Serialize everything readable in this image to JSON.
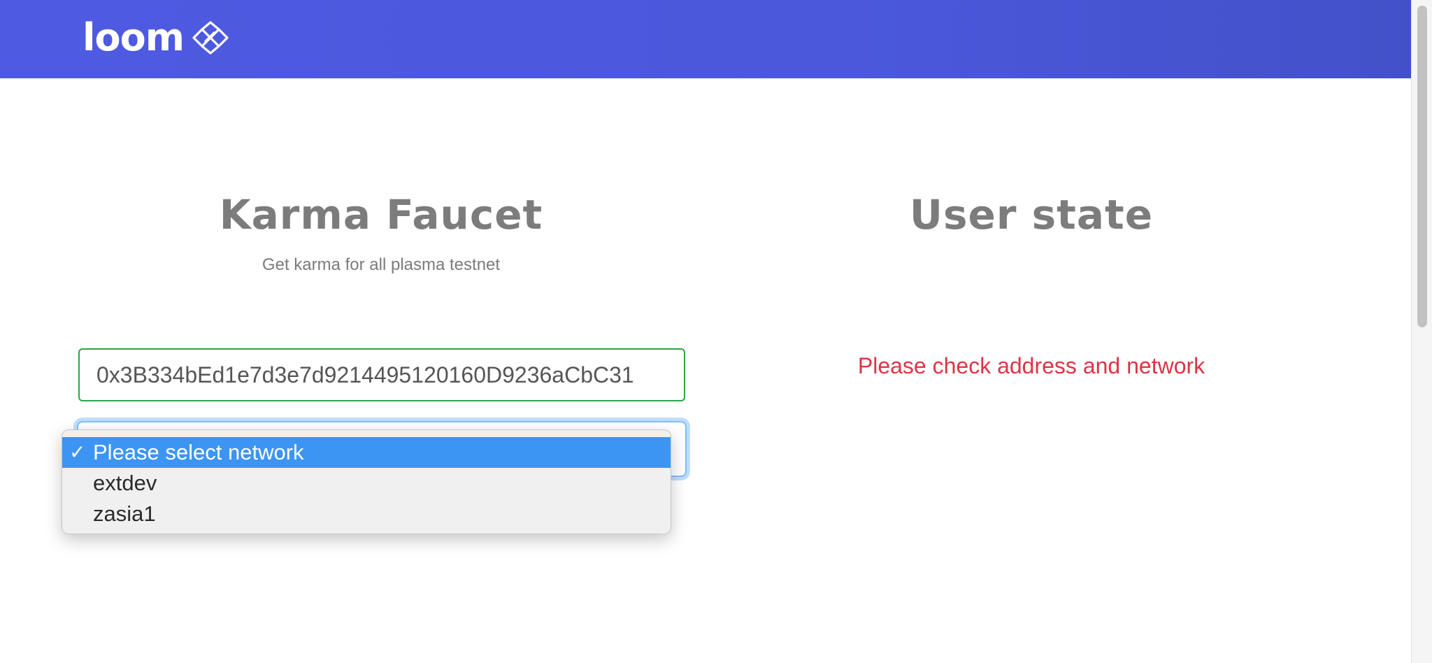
{
  "header": {
    "logo_text": "loom",
    "logo_icon": "loom-network-icon",
    "brand_color": "#4e5ae2"
  },
  "faucet": {
    "title": "Karma Faucet",
    "subtitle": "Get karma for all plasma testnet",
    "address_value": "0x3B334bEd1e7d3e7d9214495120160D9236aCbC31",
    "network_select": {
      "selected": "Please select network",
      "options": [
        "Please select network",
        "extdev",
        "zasia1"
      ]
    }
  },
  "user_state": {
    "title": "User state",
    "message": "Please check address and network"
  },
  "colors": {
    "valid_border": "#28a745",
    "error_text": "#dc3545",
    "selected_option": "#3d95f3"
  }
}
